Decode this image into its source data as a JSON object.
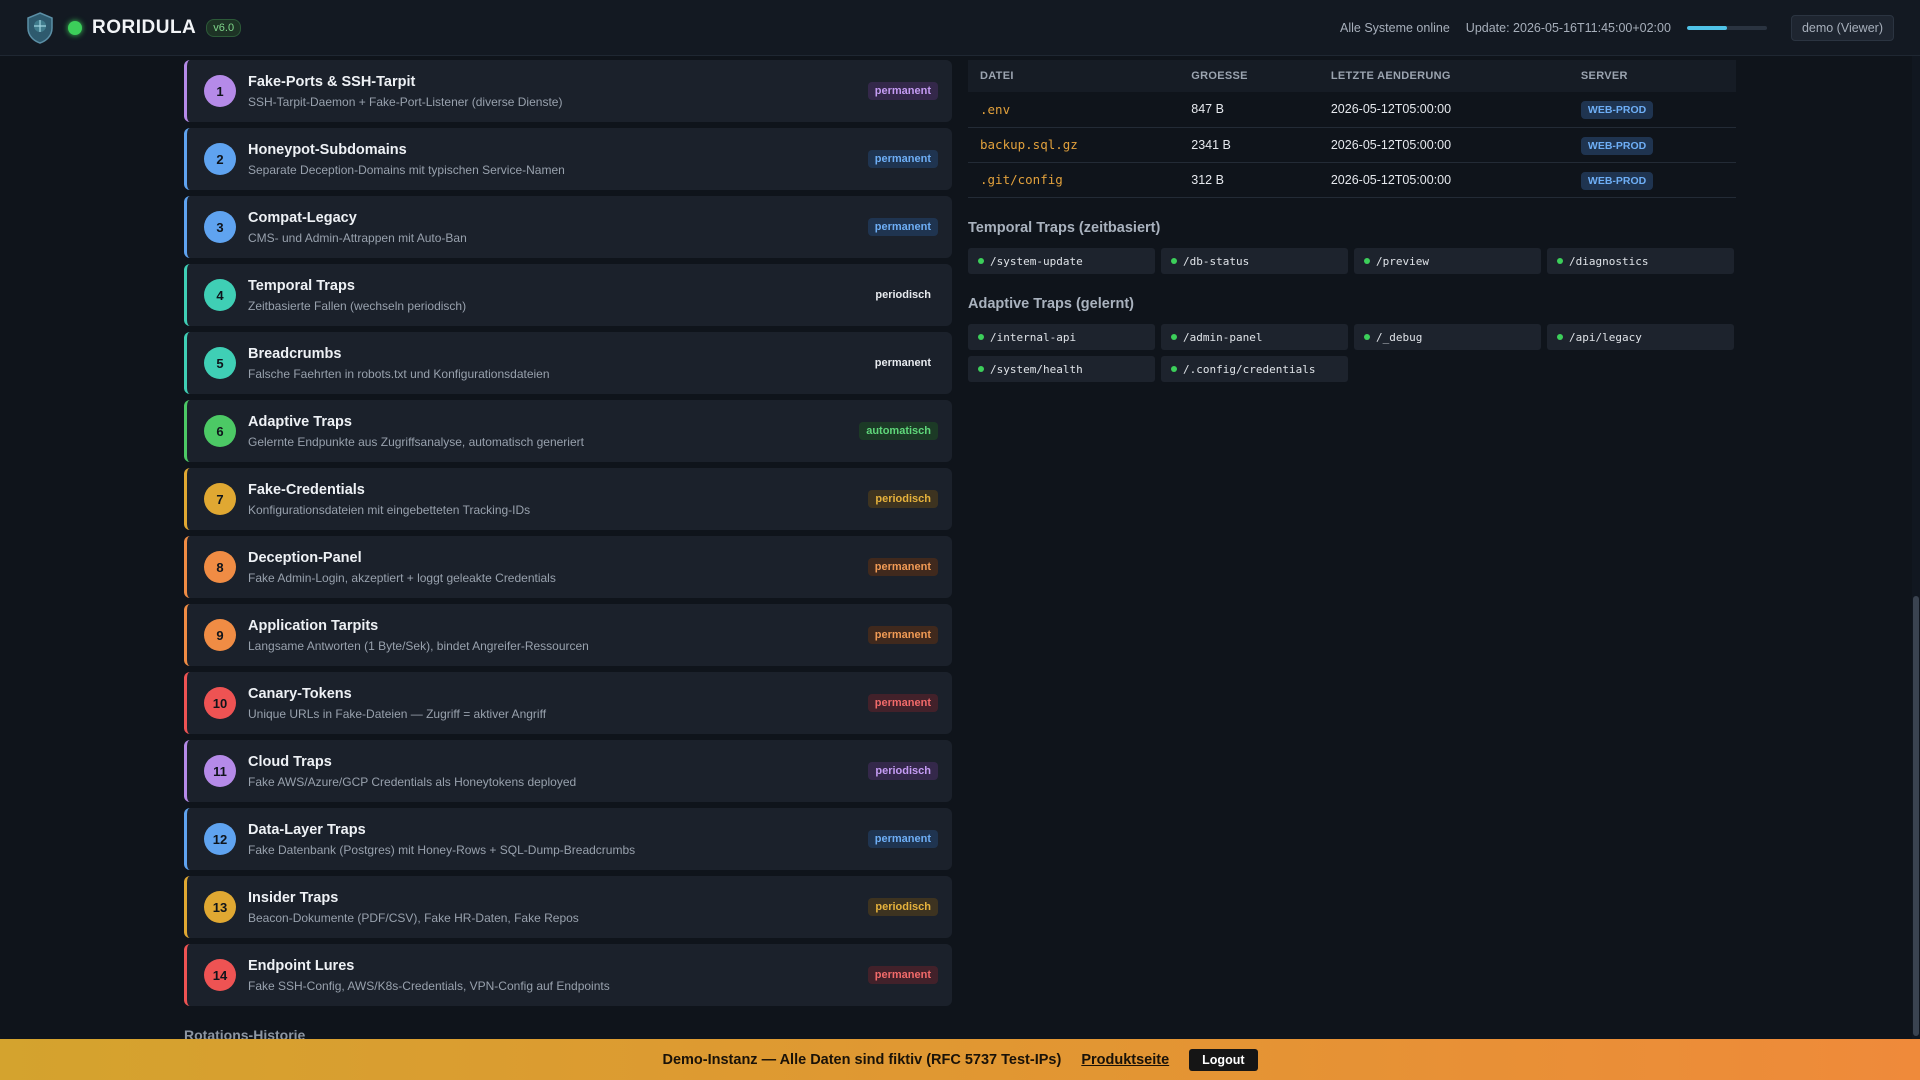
{
  "header": {
    "brand": "RORIDULA",
    "version": "v6.0",
    "systems_status": "Alle Systeme online",
    "update_label": "Update: 2026-05-16T11:45:00+02:00",
    "refresh_progress": 0.5,
    "user": "demo (Viewer)"
  },
  "traps": [
    {
      "num": "1",
      "title": "Fake-Ports & SSH-Tarpit",
      "desc": "SSH-Tarpit-Daemon + Fake-Port-Listener (diverse Dienste)",
      "badge": "permanent",
      "color": "#b58ae8",
      "badge_style": "b-purple"
    },
    {
      "num": "2",
      "title": "Honeypot-Subdomains",
      "desc": "Separate Deception-Domains mit typischen Service-Namen",
      "badge": "permanent",
      "color": "#5fa3f0",
      "badge_style": "b-blue"
    },
    {
      "num": "3",
      "title": "Compat-Legacy",
      "desc": "CMS- und Admin-Attrappen mit Auto-Ban",
      "badge": "permanent",
      "color": "#5fa3f0",
      "badge_style": "b-blue"
    },
    {
      "num": "4",
      "title": "Temporal Traps",
      "desc": "Zeitbasierte Fallen (wechseln periodisch)",
      "badge": "periodisch",
      "color": "#3fcfb5",
      "badge_style": "b-plain"
    },
    {
      "num": "5",
      "title": "Breadcrumbs",
      "desc": "Falsche Faehrten in robots.txt und Konfigurationsdateien",
      "badge": "permanent",
      "color": "#3fcfb5",
      "badge_style": "b-plain"
    },
    {
      "num": "6",
      "title": "Adaptive Traps",
      "desc": "Gelernte Endpunkte aus Zugriffsanalyse, automatisch generiert",
      "badge": "automatisch",
      "color": "#4cc965",
      "badge_style": "b-green"
    },
    {
      "num": "7",
      "title": "Fake-Credentials",
      "desc": "Konfigurationsdateien mit eingebetteten Tracking-IDs",
      "badge": "periodisch",
      "color": "#e0a832",
      "badge_style": "b-amber"
    },
    {
      "num": "8",
      "title": "Deception-Panel",
      "desc": "Fake Admin-Login, akzeptiert + loggt geleakte Credentials",
      "badge": "permanent",
      "color": "#f08c44",
      "badge_style": "b-orange"
    },
    {
      "num": "9",
      "title": "Application Tarpits",
      "desc": "Langsame Antworten (1 Byte/Sek), bindet Angreifer-Ressourcen",
      "badge": "permanent",
      "color": "#f08c44",
      "badge_style": "b-orange"
    },
    {
      "num": "10",
      "title": "Canary-Tokens",
      "desc": "Unique URLs in Fake-Dateien — Zugriff = aktiver Angriff",
      "badge": "permanent",
      "color": "#ee5353",
      "badge_style": "b-red"
    },
    {
      "num": "11",
      "title": "Cloud Traps",
      "desc": "Fake AWS/Azure/GCP Credentials als Honeytokens deployed",
      "badge": "periodisch",
      "color": "#b58ae8",
      "badge_style": "b-purple"
    },
    {
      "num": "12",
      "title": "Data-Layer Traps",
      "desc": "Fake Datenbank (Postgres) mit Honey-Rows + SQL-Dump-Breadcrumbs",
      "badge": "permanent",
      "color": "#5fa3f0",
      "badge_style": "b-blue"
    },
    {
      "num": "13",
      "title": "Insider Traps",
      "desc": "Beacon-Dokumente (PDF/CSV), Fake HR-Daten, Fake Repos",
      "badge": "periodisch",
      "color": "#e0a832",
      "badge_style": "b-amber"
    },
    {
      "num": "14",
      "title": "Endpoint Lures",
      "desc": "Fake SSH-Config, AWS/K8s-Credentials, VPN-Config auf Endpoints",
      "badge": "permanent",
      "color": "#ee5353",
      "badge_style": "b-red"
    }
  ],
  "rotation_history_title": "Rotations-Historie",
  "files_table": {
    "columns": [
      "DATEI",
      "GROESSE",
      "LETZTE AENDERUNG",
      "SERVER"
    ],
    "rows": [
      {
        "file": ".env",
        "size": "847 B",
        "modified": "2026-05-12T05:00:00",
        "server": "WEB-PROD"
      },
      {
        "file": "backup.sql.gz",
        "size": "2341 B",
        "modified": "2026-05-12T05:00:00",
        "server": "WEB-PROD"
      },
      {
        "file": ".git/config",
        "size": "312 B",
        "modified": "2026-05-12T05:00:00",
        "server": "WEB-PROD"
      }
    ]
  },
  "temporal": {
    "title": "Temporal Traps (zeitbasiert)",
    "items": [
      "/system-update",
      "/db-status",
      "/preview",
      "/diagnostics"
    ]
  },
  "adaptive": {
    "title": "Adaptive Traps (gelernt)",
    "items": [
      "/internal-api",
      "/admin-panel",
      "/_debug",
      "/api/legacy",
      "/system/health",
      "/.config/credentials"
    ]
  },
  "banner": {
    "text": "Demo-Instanz — Alle Daten sind fiktiv (RFC 5737 Test-IPs)",
    "link": "Produktseite",
    "logout": "Logout"
  }
}
